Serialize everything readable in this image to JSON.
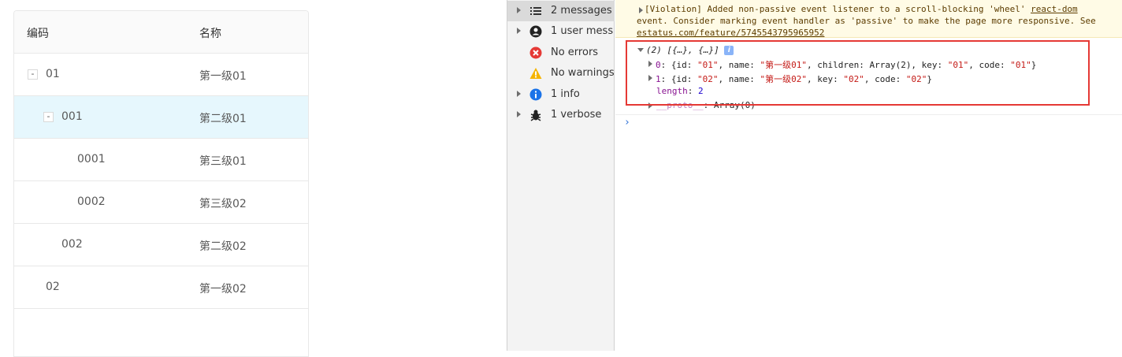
{
  "table": {
    "headers": {
      "code": "编码",
      "name": "名称"
    },
    "rows": [
      {
        "code": "01",
        "name": "第一级01",
        "expand": "-"
      },
      {
        "code": "001",
        "name": "第二级01",
        "expand": "-"
      },
      {
        "code": "0001",
        "name": "第三级01"
      },
      {
        "code": "0002",
        "name": "第三级02"
      },
      {
        "code": "002",
        "name": "第二级02"
      },
      {
        "code": "02",
        "name": "第一级02"
      }
    ]
  },
  "devtools": {
    "sidebar": [
      {
        "label": "2 messages",
        "icon": "list-icon"
      },
      {
        "label": "1 user mess...",
        "icon": "user-icon"
      },
      {
        "label": "No errors",
        "icon": "error-icon"
      },
      {
        "label": "No warnings",
        "icon": "warning-icon"
      },
      {
        "label": "1 info",
        "icon": "info-icon"
      },
      {
        "label": "1 verbose",
        "icon": "bug-icon"
      }
    ],
    "violation": {
      "line1": "[Violation] Added non-passive event listener to a scroll-blocking 'wheel'",
      "line1_link": "react-dom",
      "line2": "event. Consider marking event handler as 'passive' to make the page more responsive. See",
      "line3_link": "estatus.com/feature/5745543795965952"
    },
    "log": {
      "summary": "(2) [{…}, {…}]",
      "info_badge": "i",
      "item0": {
        "index": "0",
        "text_pre": "{id: ",
        "id": "\"01\"",
        "name_key": ", name: ",
        "name": "\"第一级01\"",
        "children": ", children: Array(2), key: ",
        "key": "\"01\"",
        "code_key": ", code: ",
        "code": "\"01\"",
        "close": "}"
      },
      "item1": {
        "index": "1",
        "text_pre": "{id: ",
        "id": "\"02\"",
        "name_key": ", name: ",
        "name": "\"第一级02\"",
        "key_key": ", key: ",
        "key": "\"02\"",
        "code_key": ", code: ",
        "code": "\"02\"",
        "close": "}"
      },
      "length_key": "length",
      "length_val": "2",
      "proto_key": "__proto__",
      "proto_val": ": Array(0)"
    },
    "prompt": "›"
  },
  "colors": {
    "selected_row": "#e6f7fd",
    "highlight_border": "#e53935",
    "violation_bg": "#fffbe6"
  }
}
